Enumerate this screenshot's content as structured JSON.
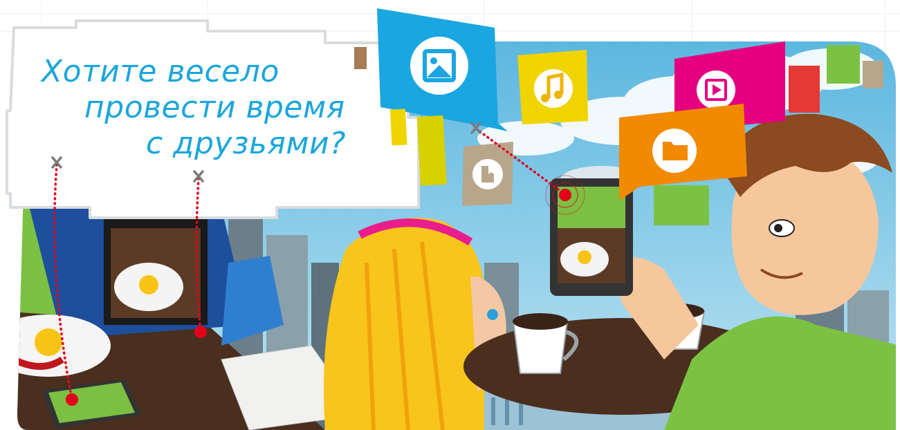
{
  "headline": {
    "line1": "Хотите весело",
    "line2": "провести время",
    "line3": "с друзьями?"
  },
  "tiles": [
    {
      "icon": "picture-icon",
      "color": "#1aa6e0"
    },
    {
      "icon": "music-note-icon",
      "color": "#f0d400"
    },
    {
      "icon": "play-icon",
      "color": "#e4007f"
    },
    {
      "icon": "folder-icon",
      "color": "#f18a00"
    },
    {
      "icon": "book-icon",
      "color": "#a8957c"
    }
  ],
  "colors": {
    "accent": "#1aa6dc",
    "dotted_line": "#e3001b"
  }
}
